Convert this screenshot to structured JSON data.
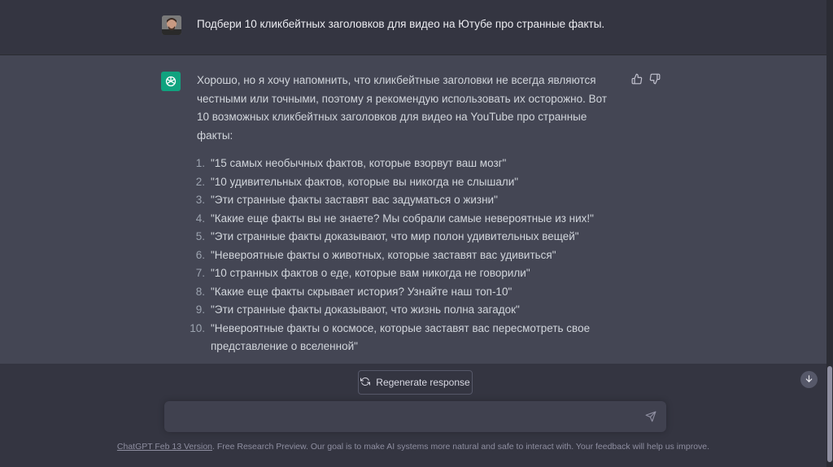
{
  "user_message": {
    "text": "Подбери 10 кликбейтных заголовков для видео на Ютубе про странные факты."
  },
  "assistant_message": {
    "intro": "Хорошо, но я хочу напомнить, что кликбейтные заголовки не всегда являются честными или точными, поэтому я рекомендую использовать их осторожно. Вот 10 возможных кликбейтных заголовков для видео на YouTube про странные факты:",
    "items": [
      {
        "num": "1.",
        "text": "\"15 самых необычных фактов, которые взорвут ваш мозг\""
      },
      {
        "num": "2.",
        "text": "\"10 удивительных фактов, которые вы никогда не слышали\""
      },
      {
        "num": "3.",
        "text": "\"Эти странные факты заставят вас задуматься о жизни\""
      },
      {
        "num": "4.",
        "text": "\"Какие еще факты вы не знаете? Мы собрали самые невероятные из них!\""
      },
      {
        "num": "5.",
        "text": "\"Эти странные факты доказывают, что мир полон удивительных вещей\""
      },
      {
        "num": "6.",
        "text": "\"Невероятные факты о животных, которые заставят вас удивиться\""
      },
      {
        "num": "7.",
        "text": "\"10 странных фактов о еде, которые вам никогда не говорили\""
      },
      {
        "num": "8.",
        "text": "\"Какие еще факты скрывает история? Узнайте наш топ-10\""
      },
      {
        "num": "9.",
        "text": "\"Эти странные факты доказывают, что жизнь полна загадок\""
      },
      {
        "num": "10.",
        "text": "\"Невероятные факты о космосе, которые заставят вас пересмотреть свое представление о вселенной\""
      }
    ]
  },
  "icons": {
    "like": "thumbs-up-icon",
    "dislike": "thumbs-down-icon",
    "regenerate": "refresh-icon",
    "send": "send-icon",
    "scroll": "arrow-down-icon"
  },
  "regenerate_label": "Regenerate response",
  "composer": {
    "placeholder": "",
    "value": ""
  },
  "footer": {
    "link": "ChatGPT Feb 13 Version",
    "text": ". Free Research Preview. Our goal is to make AI systems more natural and safe to interact with. Your feedback will help us improve."
  },
  "colors": {
    "accent": "#10a37f",
    "background": "#343541",
    "assistant_background": "#444654"
  }
}
